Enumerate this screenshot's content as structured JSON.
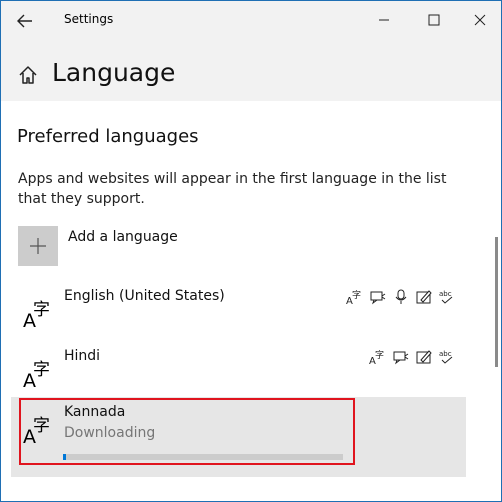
{
  "window": {
    "title": "Settings"
  },
  "header": {
    "title": "Language"
  },
  "section": {
    "title": "Preferred languages",
    "description": "Apps and websites will appear in the first language in the list that they support."
  },
  "add_language": {
    "label": "Add a language"
  },
  "languages": [
    {
      "name": "English (United States)",
      "status": "",
      "capabilities": [
        "language-pack-icon",
        "text-to-speech-icon",
        "speech-recognition-icon",
        "handwriting-icon",
        "spellcheck-icon"
      ]
    },
    {
      "name": "Hindi",
      "status": "",
      "capabilities": [
        "language-pack-icon",
        "text-to-speech-icon",
        "handwriting-icon",
        "spellcheck-icon"
      ]
    },
    {
      "name": "Kannada",
      "status": "Downloading",
      "progress": 0.01
    }
  ],
  "colors": {
    "accent": "#0078d7",
    "highlight": "#e0141e",
    "selected_bg": "#e6e6e6"
  }
}
